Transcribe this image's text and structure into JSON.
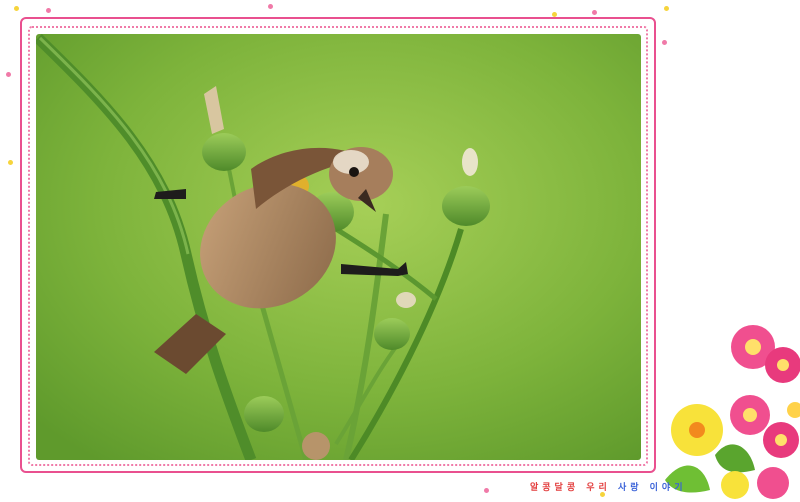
{
  "image": {
    "subject": "bird-on-plant-stem",
    "frame_color": "#e9508f",
    "background_color": "#7fb43a"
  },
  "caption": {
    "part1": "알콩달콩 우리",
    "part2": " 사랑 이야기"
  }
}
